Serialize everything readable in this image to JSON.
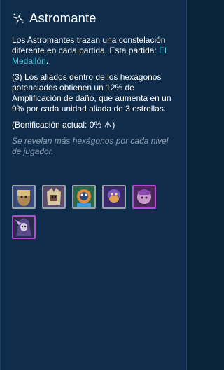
{
  "trait": {
    "name": "Astromante",
    "icon": "astromancer-star-icon",
    "description_part1": "Los Astromantes trazan una constelación diferente en cada partida. Esta partida: ",
    "current_pattern": "El Medallón",
    "description_end": ".",
    "effect_text": "(3) Los aliados dentro de los hexágonos potenciados obtienen un 12% de Amplificación de daño, que aumenta en un 9% por cada unidad aliada de 3 estrellas.",
    "bonus_prefix": "(Bonificación actual: 0% ",
    "bonus_icon": "damage-amp-icon",
    "bonus_suffix": ")",
    "hint": "Se revelan más hexágonos por cada nivel de jugador."
  },
  "colors": {
    "panel_bg": "#0f2c4a",
    "link": "#4cc6e0",
    "hint": "#8c9fb4",
    "cost1_border": "#9aa4b0",
    "cost3_border": "#c9b46a",
    "cost4_border": "#b44ad0"
  },
  "units": [
    {
      "icon": "champion-portrait-1",
      "cost_tier": "c1"
    },
    {
      "icon": "champion-portrait-2",
      "cost_tier": "c1"
    },
    {
      "icon": "champion-portrait-3",
      "cost_tier": "c1"
    },
    {
      "icon": "champion-portrait-4",
      "cost_tier": "c1"
    },
    {
      "icon": "champion-portrait-5",
      "cost_tier": "c4"
    },
    {
      "icon": "champion-portrait-6",
      "cost_tier": "c4"
    }
  ]
}
